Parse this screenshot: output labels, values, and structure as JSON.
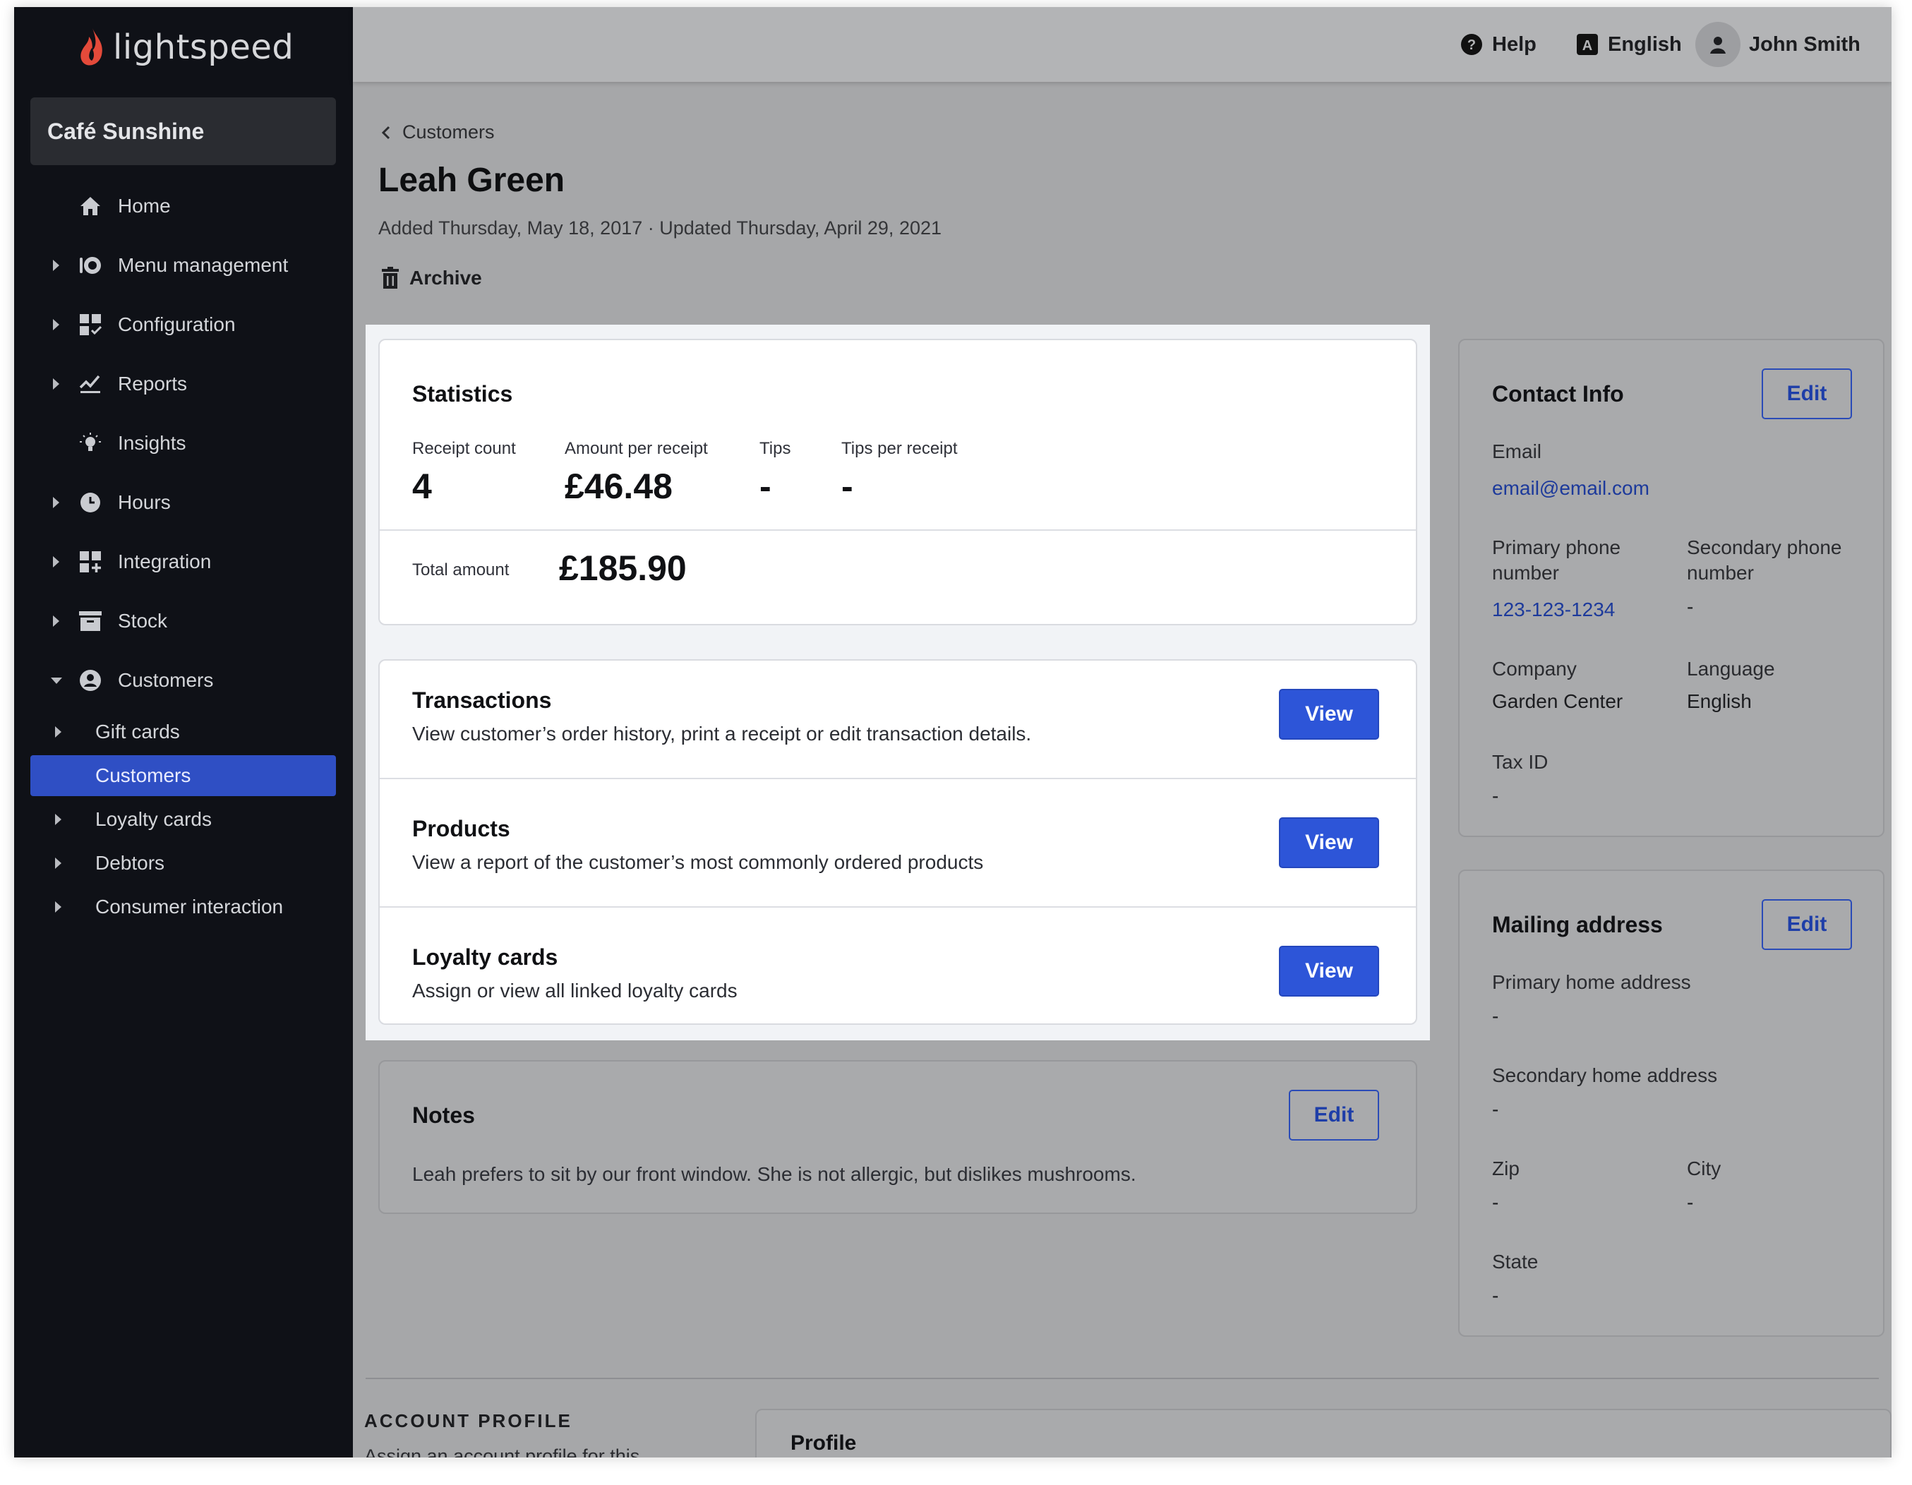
{
  "app": {
    "logo_text": "lightspeed",
    "store_name": "Café Sunshine"
  },
  "sidebar": {
    "items": [
      {
        "label": "Home",
        "icon": "home-icon",
        "has_caret": false
      },
      {
        "label": "Menu management",
        "icon": "menu-icon",
        "has_caret": true
      },
      {
        "label": "Configuration",
        "icon": "configuration-icon",
        "has_caret": true
      },
      {
        "label": "Reports",
        "icon": "reports-icon",
        "has_caret": true
      },
      {
        "label": "Insights",
        "icon": "lightbulb-icon",
        "has_caret": false
      },
      {
        "label": "Hours",
        "icon": "clock-icon",
        "has_caret": true
      },
      {
        "label": "Integration",
        "icon": "integration-icon",
        "has_caret": true
      },
      {
        "label": "Stock",
        "icon": "stock-icon",
        "has_caret": true
      },
      {
        "label": "Customers",
        "icon": "customers-icon",
        "has_caret": true,
        "expanded": true
      }
    ],
    "sub_items": [
      {
        "label": "Gift cards",
        "has_caret": true,
        "active": false
      },
      {
        "label": "Customers",
        "has_caret": false,
        "active": true
      },
      {
        "label": "Loyalty cards",
        "has_caret": true,
        "active": false
      },
      {
        "label": "Debtors",
        "has_caret": true,
        "active": false
      },
      {
        "label": "Consumer interaction",
        "has_caret": true,
        "active": false
      }
    ]
  },
  "topbar": {
    "help": "Help",
    "language": "English",
    "user": "John Smith"
  },
  "page": {
    "breadcrumb": "Customers",
    "title": "Leah Green",
    "meta": "Added Thursday, May 18, 2017 · Updated Thursday, April 29, 2021",
    "archive": "Archive"
  },
  "statistics": {
    "title": "Statistics",
    "receipt_count_label": "Receipt count",
    "receipt_count": "4",
    "amount_per_receipt_label": "Amount per receipt",
    "amount_per_receipt": "£46.48",
    "tips_label": "Tips",
    "tips": "-",
    "tips_per_receipt_label": "Tips per receipt",
    "tips_per_receipt": "-",
    "total_amount_label": "Total amount",
    "total_amount": "£185.90"
  },
  "actions": [
    {
      "title": "Transactions",
      "description": "View customer’s order history, print a receipt or edit transaction details.",
      "button": "View"
    },
    {
      "title": "Products",
      "description": "View a report of the customer’s most commonly ordered products",
      "button": "View"
    },
    {
      "title": "Loyalty cards",
      "description": "Assign or view all linked loyalty cards",
      "button": "View"
    }
  ],
  "notes": {
    "title": "Notes",
    "button": "Edit",
    "text": "Leah prefers to sit by our front window. She is not allergic, but dislikes mushrooms."
  },
  "contact": {
    "title": "Contact Info",
    "button": "Edit",
    "email_label": "Email",
    "email": "email@email.com",
    "primary_phone_label_1": "Primary phone",
    "primary_phone_label_2": "number",
    "primary_phone": "123-123-1234",
    "secondary_phone_label_1": "Secondary phone",
    "secondary_phone_label_2": "number",
    "secondary_phone": "-",
    "company_label": "Company",
    "company": "Garden Center",
    "language_label": "Language",
    "language": "English",
    "tax_id_label": "Tax ID",
    "tax_id": "-"
  },
  "mailing": {
    "title": "Mailing address",
    "button": "Edit",
    "primary_label": "Primary home address",
    "primary": "-",
    "secondary_label": "Secondary home address",
    "secondary": "-",
    "zip_label": "Zip",
    "zip": "-",
    "city_label": "City",
    "city": "-",
    "state_label": "State",
    "state": "-"
  },
  "account_profile": {
    "title": "ACCOUNT PROFILE",
    "description": "Assign an account profile for this",
    "card_title": "Profile"
  },
  "colors": {
    "sidebar": "#0f1117",
    "accent": "#2d55d8",
    "active_nav": "#2f4fc4",
    "link": "#1d3a9b"
  }
}
